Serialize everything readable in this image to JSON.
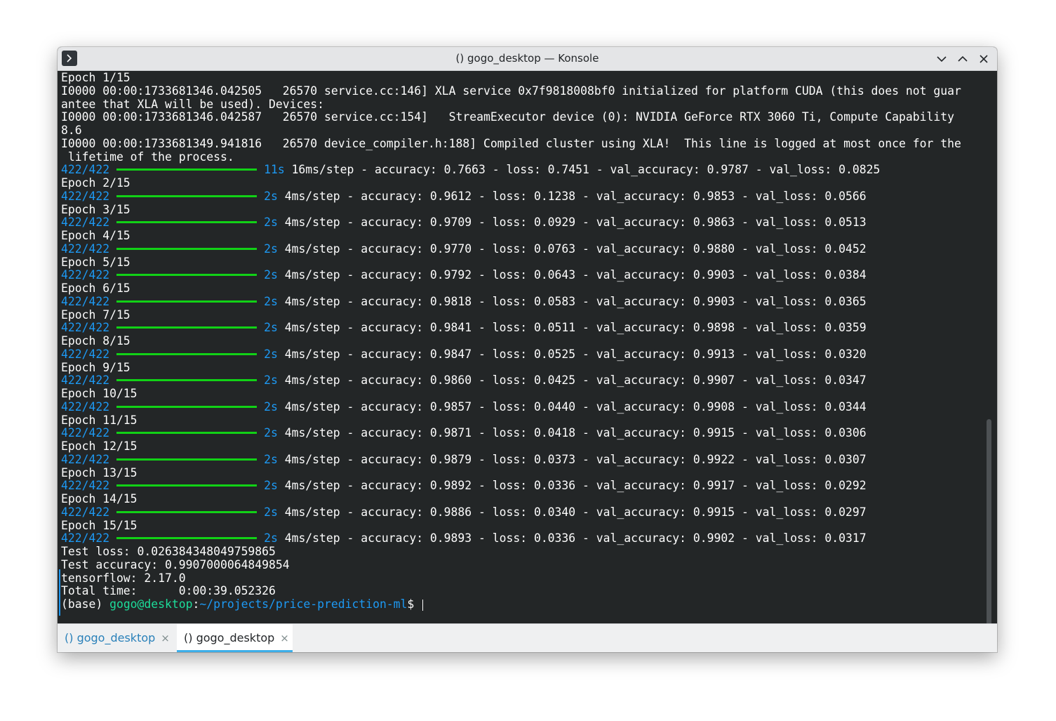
{
  "window": {
    "title": "() gogo_desktop — Konsole",
    "icons": [
      "terminal-icon",
      "minimize-icon",
      "maximize-icon",
      "close-icon"
    ]
  },
  "terminal": {
    "lines": [
      {
        "type": "text",
        "text": "Epoch 1/15"
      },
      {
        "type": "text",
        "text": "I0000 00:00:1733681346.042505   26570 service.cc:146] XLA service 0x7f9818008bf0 initialized for platform CUDA (this does not guar"
      },
      {
        "type": "text",
        "text": "antee that XLA will be used). Devices:"
      },
      {
        "type": "text",
        "text": "I0000 00:00:1733681346.042587   26570 service.cc:154]   StreamExecutor device (0): NVIDIA GeForce RTX 3060 Ti, Compute Capability"
      },
      {
        "type": "text",
        "text": "8.6"
      },
      {
        "type": "text",
        "text": "I0000 00:00:1733681349.941816   26570 device_compiler.h:188] Compiled cluster using XLA!  This line is logged at most once for the"
      },
      {
        "type": "text",
        "text": " lifetime of the process."
      },
      {
        "type": "progress",
        "steps": "422/422",
        "fraction": 1.0,
        "time": "11s",
        "rest": "16ms/step - accuracy: 0.7663 - loss: 0.7451 - val_accuracy: 0.9787 - val_loss: 0.0825"
      },
      {
        "type": "text",
        "text": "Epoch 2/15"
      },
      {
        "type": "progress",
        "steps": "422/422",
        "fraction": 1.0,
        "time": "2s",
        "rest": "4ms/step - accuracy: 0.9612 - loss: 0.1238 - val_accuracy: 0.9853 - val_loss: 0.0566"
      },
      {
        "type": "text",
        "text": "Epoch 3/15"
      },
      {
        "type": "progress",
        "steps": "422/422",
        "fraction": 1.0,
        "time": "2s",
        "rest": "4ms/step - accuracy: 0.9709 - loss: 0.0929 - val_accuracy: 0.9863 - val_loss: 0.0513"
      },
      {
        "type": "text",
        "text": "Epoch 4/15"
      },
      {
        "type": "progress",
        "steps": "422/422",
        "fraction": 1.0,
        "time": "2s",
        "rest": "4ms/step - accuracy: 0.9770 - loss: 0.0763 - val_accuracy: 0.9880 - val_loss: 0.0452"
      },
      {
        "type": "text",
        "text": "Epoch 5/15"
      },
      {
        "type": "progress",
        "steps": "422/422",
        "fraction": 1.0,
        "time": "2s",
        "rest": "4ms/step - accuracy: 0.9792 - loss: 0.0643 - val_accuracy: 0.9903 - val_loss: 0.0384"
      },
      {
        "type": "text",
        "text": "Epoch 6/15"
      },
      {
        "type": "progress",
        "steps": "422/422",
        "fraction": 1.0,
        "time": "2s",
        "rest": "4ms/step - accuracy: 0.9818 - loss: 0.0583 - val_accuracy: 0.9903 - val_loss: 0.0365"
      },
      {
        "type": "text",
        "text": "Epoch 7/15"
      },
      {
        "type": "progress",
        "steps": "422/422",
        "fraction": 1.0,
        "time": "2s",
        "rest": "4ms/step - accuracy: 0.9841 - loss: 0.0511 - val_accuracy: 0.9898 - val_loss: 0.0359"
      },
      {
        "type": "text",
        "text": "Epoch 8/15"
      },
      {
        "type": "progress",
        "steps": "422/422",
        "fraction": 1.0,
        "time": "2s",
        "rest": "4ms/step - accuracy: 0.9847 - loss: 0.0525 - val_accuracy: 0.9913 - val_loss: 0.0320"
      },
      {
        "type": "text",
        "text": "Epoch 9/15"
      },
      {
        "type": "progress",
        "steps": "422/422",
        "fraction": 1.0,
        "time": "2s",
        "rest": "4ms/step - accuracy: 0.9860 - loss: 0.0425 - val_accuracy: 0.9907 - val_loss: 0.0347"
      },
      {
        "type": "text",
        "text": "Epoch 10/15"
      },
      {
        "type": "progress",
        "steps": "422/422",
        "fraction": 1.0,
        "time": "2s",
        "rest": "4ms/step - accuracy: 0.9857 - loss: 0.0440 - val_accuracy: 0.9908 - val_loss: 0.0344"
      },
      {
        "type": "text",
        "text": "Epoch 11/15"
      },
      {
        "type": "progress",
        "steps": "422/422",
        "fraction": 1.0,
        "time": "2s",
        "rest": "4ms/step - accuracy: 0.9871 - loss: 0.0418 - val_accuracy: 0.9915 - val_loss: 0.0306"
      },
      {
        "type": "text",
        "text": "Epoch 12/15"
      },
      {
        "type": "progress",
        "steps": "422/422",
        "fraction": 1.0,
        "time": "2s",
        "rest": "4ms/step - accuracy: 0.9879 - loss: 0.0373 - val_accuracy: 0.9922 - val_loss: 0.0307"
      },
      {
        "type": "text",
        "text": "Epoch 13/15"
      },
      {
        "type": "progress",
        "steps": "422/422",
        "fraction": 1.0,
        "time": "2s",
        "rest": "4ms/step - accuracy: 0.9892 - loss: 0.0336 - val_accuracy: 0.9917 - val_loss: 0.0292"
      },
      {
        "type": "text",
        "text": "Epoch 14/15"
      },
      {
        "type": "progress",
        "steps": "422/422",
        "fraction": 1.0,
        "time": "2s",
        "rest": "4ms/step - accuracy: 0.9886 - loss: 0.0340 - val_accuracy: 0.9915 - val_loss: 0.0297"
      },
      {
        "type": "text",
        "text": "Epoch 15/15"
      },
      {
        "type": "progress",
        "steps": "422/422",
        "fraction": 1.0,
        "time": "2s",
        "rest": "4ms/step - accuracy: 0.9893 - loss: 0.0336 - val_accuracy: 0.9902 - val_loss: 0.0317"
      },
      {
        "type": "text",
        "text": "Test loss: 0.026384348049759865"
      },
      {
        "type": "text",
        "text": "Test accuracy: 0.9907000064849854"
      },
      {
        "type": "text",
        "text": "tensorflow: 2.17.0"
      },
      {
        "type": "text",
        "text": "Total time:      0:00:39.052326"
      },
      {
        "type": "prompt",
        "env": "(base) ",
        "user_host": "gogo@desktop",
        "colon": ":",
        "path": "~/projects/price-prediction-ml",
        "symbol": "$ "
      }
    ]
  },
  "tabs": [
    {
      "label": "() gogo_desktop",
      "active": false,
      "close": "×"
    },
    {
      "label": "() gogo_desktop",
      "active": true,
      "close": "×"
    }
  ],
  "colors": {
    "background": "#232627",
    "foreground": "#fcfcfc",
    "blue": "#1d99f3",
    "green": "#1cdc9a",
    "progress_bar": "#11d116",
    "tab_accent": "#3daee9"
  }
}
